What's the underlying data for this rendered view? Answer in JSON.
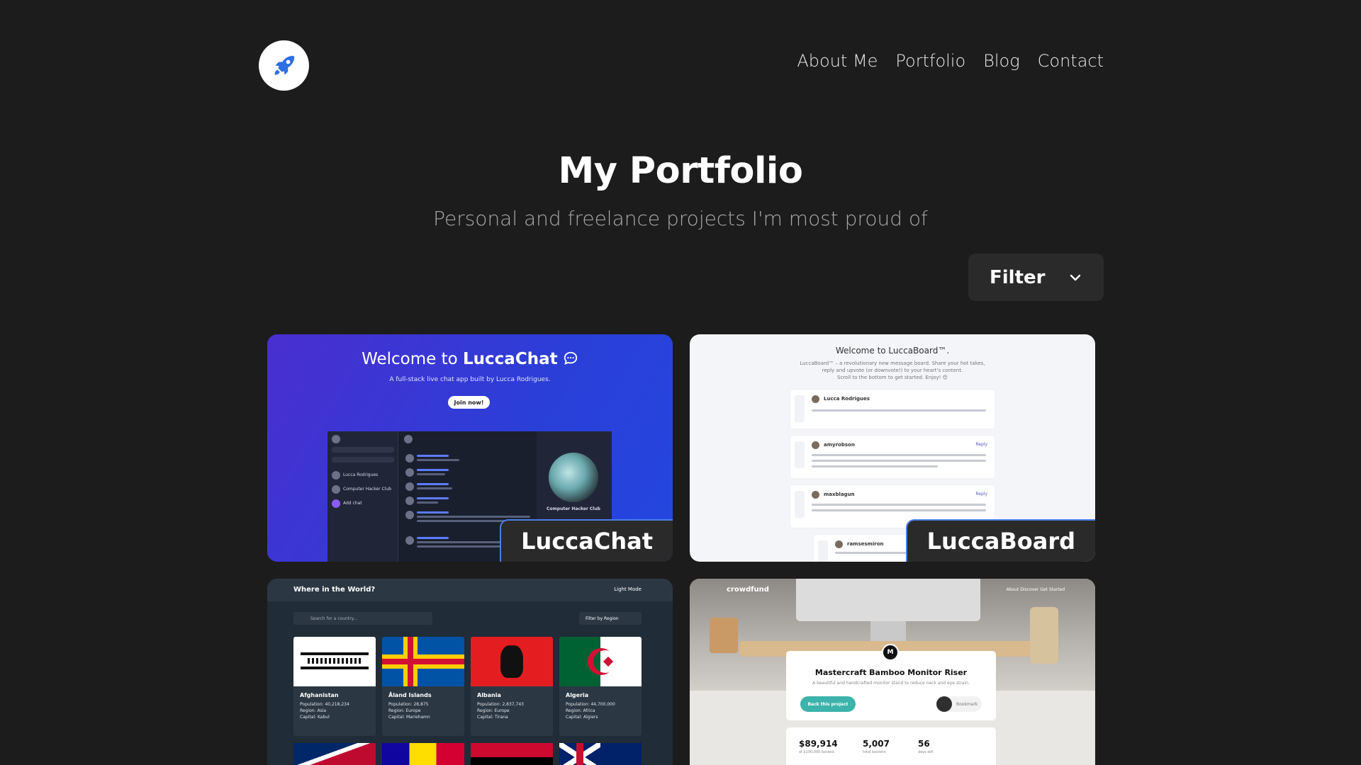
{
  "nav": {
    "links": [
      "About Me",
      "Portfolio",
      "Blog",
      "Contact"
    ]
  },
  "header": {
    "title": "My Portfolio",
    "subtitle": "Personal and freelance projects I'm most proud of"
  },
  "filter": {
    "label": "Filter"
  },
  "icons": {
    "logo": "rocket-icon",
    "filter": "chevron-down-icon"
  },
  "colors": {
    "background": "#1d1c1c",
    "accent": "#4a7ee9",
    "logo_blue": "#2f6fe3"
  },
  "cards": [
    {
      "label": "LuccaChat",
      "preview": {
        "welcome_prefix": "Welcome to",
        "welcome_brand": "LuccaChat",
        "tagline": "A full-stack live chat app built by Lucca Rodrigues.",
        "button": "Join now!",
        "side_items": [
          "Lucca Rodrigues",
          "Computer Hacker Club",
          "Add chat"
        ],
        "group_name": "Computer Hacker Club"
      }
    },
    {
      "label": "LuccaBoard",
      "preview": {
        "welcome": "Welcome to LuccaBoard™.",
        "intro_1": "LuccaBoard™ – a revolutionary new message board. Share your hot takes,",
        "intro_2": "reply and upvote (or downvote!) to your heart's content.",
        "intro_3": "Scroll to the bottom to get started. Enjoy! 😊",
        "posts": [
          "Lucca Rodrigues",
          "amyrobson",
          "maxblagun",
          "ramsesmiron"
        ],
        "reply": "Reply"
      }
    },
    {
      "label": "",
      "preview": {
        "title": "Where in the World?",
        "mode": "Light Mode",
        "search_placeholder": "Search for a country...",
        "region": "Filter by Region",
        "countries": [
          {
            "name": "Afghanistan",
            "population": "Population: 40,218,234",
            "region": "Region: Asia",
            "capital": "Capital: Kabul"
          },
          {
            "name": "Åland Islands",
            "population": "Population: 28,875",
            "region": "Region: Europe",
            "capital": "Capital: Mariehamn"
          },
          {
            "name": "Albania",
            "population": "Population: 2,837,743",
            "region": "Region: Europe",
            "capital": "Capital: Tirana"
          },
          {
            "name": "Algeria",
            "population": "Population: 44,700,000",
            "region": "Region: Africa",
            "capital": "Capital: Algiers"
          }
        ]
      }
    },
    {
      "label": "",
      "preview": {
        "brand": "crowdfund",
        "nav": "About    Discover    Get Started",
        "logo_letter": "M",
        "product": "Mastercraft Bamboo Monitor Riser",
        "desc": "A beautiful and handcrafted monitor stand to reduce neck and eye strain.",
        "back": "Back this project",
        "bookmark": "Bookmark",
        "stats": [
          {
            "value": "$89,914",
            "label": "of $100,000 backed"
          },
          {
            "value": "5,007",
            "label": "total backers"
          },
          {
            "value": "56",
            "label": "days left"
          }
        ]
      }
    }
  ]
}
